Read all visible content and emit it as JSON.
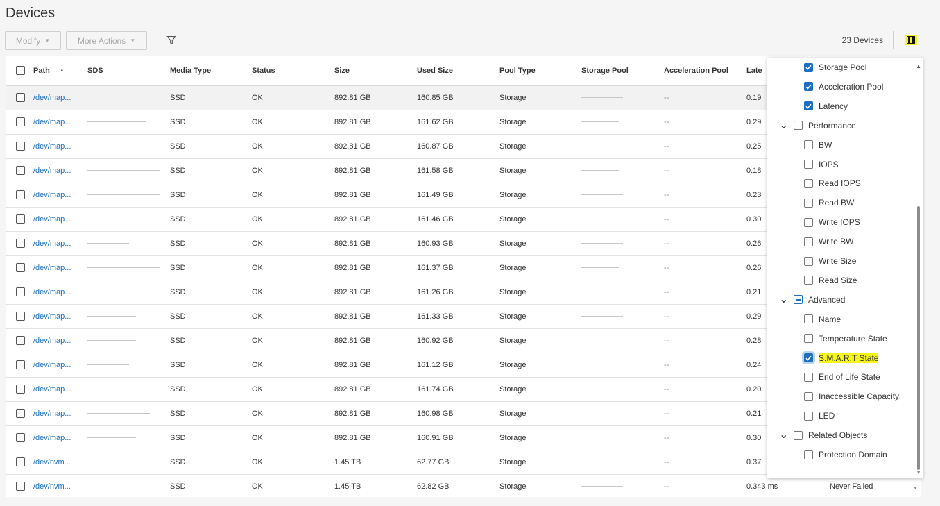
{
  "page": {
    "title": "Devices"
  },
  "toolbar": {
    "modify_label": "Modify",
    "more_actions_label": "More Actions",
    "filter_icon": "filter-icon",
    "devices_count": "23 Devices",
    "columns_icon": "columns-icon"
  },
  "table": {
    "columns": [
      "Path",
      "SDS",
      "Media Type",
      "Status",
      "Size",
      "Used Size",
      "Pool Type",
      "Storage Pool",
      "Acceleration Pool",
      "Late"
    ],
    "sort": {
      "column": "Path",
      "direction": "ascending"
    },
    "rows": [
      {
        "path": "/dev/map...",
        "media": "SSD",
        "status": "OK",
        "size": "892.81 GB",
        "used": "160.85 GB",
        "pool_type": "Storage",
        "accel": "--",
        "latency": "0.19",
        "highlighted": true
      },
      {
        "path": "/dev/map...",
        "media": "SSD",
        "status": "OK",
        "size": "892.81 GB",
        "used": "161.62 GB",
        "pool_type": "Storage",
        "accel": "--",
        "latency": "0.29"
      },
      {
        "path": "/dev/map...",
        "media": "SSD",
        "status": "OK",
        "size": "892.81 GB",
        "used": "160.87 GB",
        "pool_type": "Storage",
        "accel": "--",
        "latency": "0.25"
      },
      {
        "path": "/dev/map...",
        "media": "SSD",
        "status": "OK",
        "size": "892.81 GB",
        "used": "161.58 GB",
        "pool_type": "Storage",
        "accel": "--",
        "latency": "0.18"
      },
      {
        "path": "/dev/map...",
        "media": "SSD",
        "status": "OK",
        "size": "892.81 GB",
        "used": "161.49 GB",
        "pool_type": "Storage",
        "accel": "--",
        "latency": "0.23"
      },
      {
        "path": "/dev/map...",
        "media": "SSD",
        "status": "OK",
        "size": "892.81 GB",
        "used": "161.46 GB",
        "pool_type": "Storage",
        "accel": "--",
        "latency": "0.30"
      },
      {
        "path": "/dev/map...",
        "media": "SSD",
        "status": "OK",
        "size": "892.81 GB",
        "used": "160.93 GB",
        "pool_type": "Storage",
        "accel": "--",
        "latency": "0.26"
      },
      {
        "path": "/dev/map...",
        "media": "SSD",
        "status": "OK",
        "size": "892.81 GB",
        "used": "161.37 GB",
        "pool_type": "Storage",
        "accel": "--",
        "latency": "0.26"
      },
      {
        "path": "/dev/map...",
        "media": "SSD",
        "status": "OK",
        "size": "892.81 GB",
        "used": "161.26 GB",
        "pool_type": "Storage",
        "accel": "--",
        "latency": "0.21"
      },
      {
        "path": "/dev/map...",
        "media": "SSD",
        "status": "OK",
        "size": "892.81 GB",
        "used": "161.33 GB",
        "pool_type": "Storage",
        "accel": "--",
        "latency": "0.29"
      },
      {
        "path": "/dev/map...",
        "media": "SSD",
        "status": "OK",
        "size": "892.81 GB",
        "used": "160.92 GB",
        "pool_type": "Storage",
        "accel": "--",
        "latency": "0.28"
      },
      {
        "path": "/dev/map...",
        "media": "SSD",
        "status": "OK",
        "size": "892.81 GB",
        "used": "161.12 GB",
        "pool_type": "Storage",
        "accel": "--",
        "latency": "0.24"
      },
      {
        "path": "/dev/map...",
        "media": "SSD",
        "status": "OK",
        "size": "892.81 GB",
        "used": "161.74 GB",
        "pool_type": "Storage",
        "accel": "--",
        "latency": "0.20"
      },
      {
        "path": "/dev/map...",
        "media": "SSD",
        "status": "OK",
        "size": "892.81 GB",
        "used": "160.98 GB",
        "pool_type": "Storage",
        "accel": "--",
        "latency": "0.21"
      },
      {
        "path": "/dev/map...",
        "media": "SSD",
        "status": "OK",
        "size": "892.81 GB",
        "used": "160.91 GB",
        "pool_type": "Storage",
        "accel": "--",
        "latency": "0.30"
      },
      {
        "path": "/dev/nvm...",
        "media": "SSD",
        "status": "OK",
        "size": "1.45 TB",
        "used": "62.77 GB",
        "pool_type": "Storage",
        "accel": "--",
        "latency": "0.37"
      },
      {
        "path": "/dev/nvm...",
        "media": "SSD",
        "status": "OK",
        "size": "1.45 TB",
        "used": "62.82 GB",
        "pool_type": "Storage",
        "accel": "--",
        "latency": "0.343 ms",
        "extra": "Never Failed"
      }
    ]
  },
  "column_panel": {
    "items": [
      {
        "label": "Storage Pool",
        "state": "checked",
        "level": 1
      },
      {
        "label": "Acceleration Pool",
        "state": "checked",
        "level": 1
      },
      {
        "label": "Latency",
        "state": "checked",
        "level": 1
      },
      {
        "label": "Performance",
        "state": "unchecked",
        "level": 0,
        "group": true
      },
      {
        "label": "BW",
        "state": "unchecked",
        "level": 1
      },
      {
        "label": "IOPS",
        "state": "unchecked",
        "level": 1
      },
      {
        "label": "Read IOPS",
        "state": "unchecked",
        "level": 1
      },
      {
        "label": "Read BW",
        "state": "unchecked",
        "level": 1
      },
      {
        "label": "Write IOPS",
        "state": "unchecked",
        "level": 1
      },
      {
        "label": "Write BW",
        "state": "unchecked",
        "level": 1
      },
      {
        "label": "Write Size",
        "state": "unchecked",
        "level": 1
      },
      {
        "label": "Read Size",
        "state": "unchecked",
        "level": 1
      },
      {
        "label": "Advanced",
        "state": "partial",
        "level": 0,
        "group": true
      },
      {
        "label": "Name",
        "state": "unchecked",
        "level": 1
      },
      {
        "label": "Temperature State",
        "state": "unchecked",
        "level": 1
      },
      {
        "label": "S.M.A.R.T State",
        "state": "checked",
        "level": 1,
        "highlighted": true
      },
      {
        "label": "End of Life State",
        "state": "unchecked",
        "level": 1
      },
      {
        "label": "Inaccessible Capacity",
        "state": "unchecked",
        "level": 1
      },
      {
        "label": "LED",
        "state": "unchecked",
        "level": 1
      },
      {
        "label": "Related Objects",
        "state": "unchecked",
        "level": 0,
        "group": true
      },
      {
        "label": "Protection Domain",
        "state": "unchecked",
        "level": 1
      }
    ]
  },
  "colors": {
    "link": "#1b6ec2",
    "checkbox_checked": "#1b6ec2",
    "highlight": "#f5f51a"
  }
}
